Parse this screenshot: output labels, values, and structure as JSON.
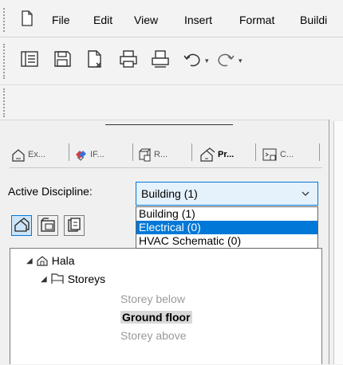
{
  "menu": {
    "items": [
      "File",
      "Edit",
      "View",
      "Insert",
      "Format",
      "Buildi"
    ]
  },
  "toolbar": {
    "buttons": [
      "info-box-icon",
      "save-icon",
      "new-document-icon",
      "print-icon",
      "plot-icon",
      "undo-icon",
      "redo-icon"
    ]
  },
  "palette": {
    "tabs": [
      {
        "label": "Ex...",
        "icon": "building-tab-icon"
      },
      {
        "label": "IF...",
        "icon": "ifc-tab-icon"
      },
      {
        "label": "R...",
        "icon": "render-tab-icon"
      },
      {
        "label": "Pr...",
        "icon": "project-tab-icon",
        "active": true
      },
      {
        "label": "C...",
        "icon": "console-tab-icon"
      }
    ],
    "discipline": {
      "label": "Active Discipline:",
      "selected": "Building (1)",
      "options": [
        "Building (1)",
        "Electrical (0)",
        "HVAC Schematic (0)"
      ],
      "highlighted": "Electrical (0)"
    },
    "tree": {
      "root": "Hala",
      "storeys_group": "Storeys",
      "storey_below": "Storey below",
      "current_storey": "Ground floor",
      "storey_above": "Storey above"
    }
  },
  "colors": {
    "accent": "#0078d7",
    "select_bg": "#e5f1fb"
  }
}
